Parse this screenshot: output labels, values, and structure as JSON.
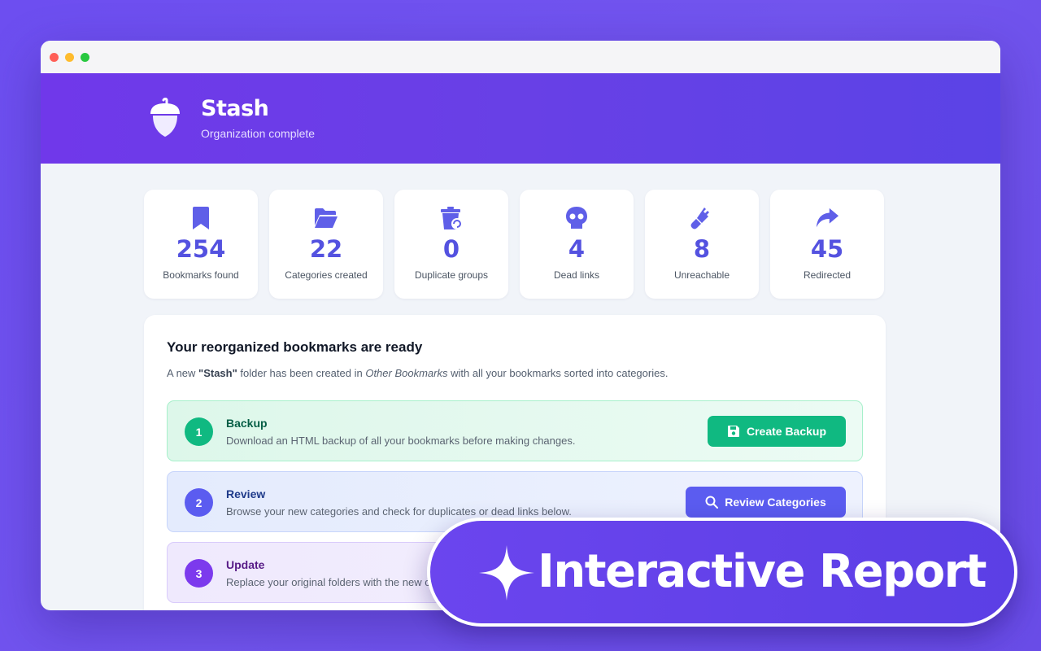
{
  "app": {
    "title": "Stash",
    "subtitle": "Organization complete"
  },
  "stats": [
    {
      "icon": "bookmark-icon",
      "value": "254",
      "label": "Bookmarks found"
    },
    {
      "icon": "folder-open-icon",
      "value": "22",
      "label": "Categories created"
    },
    {
      "icon": "trash-recycle-icon",
      "value": "0",
      "label": "Duplicate groups"
    },
    {
      "icon": "skull-icon",
      "value": "4",
      "label": "Dead links"
    },
    {
      "icon": "plug-icon",
      "value": "8",
      "label": "Unreachable"
    },
    {
      "icon": "share-arrow-icon",
      "value": "45",
      "label": "Redirected"
    }
  ],
  "panel": {
    "title": "Your reorganized bookmarks are ready",
    "desc_prefix": "A new ",
    "desc_folder": "\"Stash\"",
    "desc_mid": " folder has been created in ",
    "desc_location": "Other Bookmarks",
    "desc_suffix": " with all your bookmarks sorted into categories."
  },
  "steps": [
    {
      "number": "1",
      "title": "Backup",
      "desc": "Download an HTML backup of all your bookmarks before making changes.",
      "button": "Create Backup"
    },
    {
      "number": "2",
      "title": "Review",
      "desc": "Browse your new categories and check for duplicates or dead links below.",
      "button": "Review Categories"
    },
    {
      "number": "3",
      "title": "Update",
      "desc": "Replace your original folders with the new c"
    }
  ],
  "badge": {
    "text": "Interactive Report"
  },
  "colors": {
    "accent": "#5452e0",
    "backup_green": "#10b981",
    "review_indigo": "#5b5cf0",
    "update_purple": "#7c3aed"
  }
}
